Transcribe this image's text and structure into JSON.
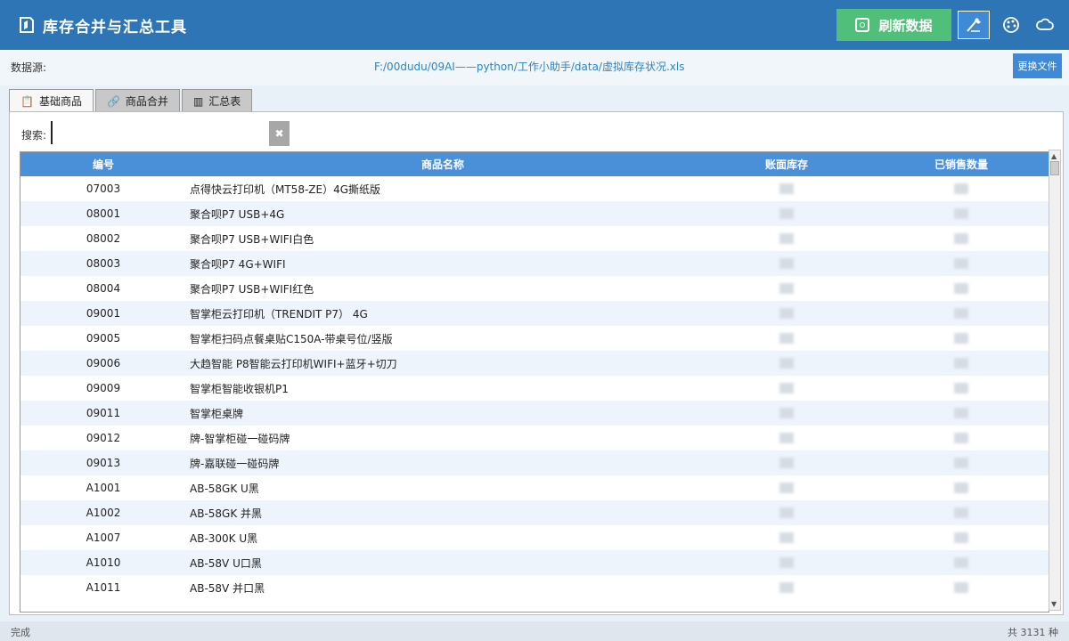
{
  "app": {
    "title": "库存合并与汇总工具"
  },
  "toolbar": {
    "refresh_label": "刷新数据",
    "icons": [
      "wand-icon",
      "palette-icon",
      "cloud-icon"
    ]
  },
  "source": {
    "label": "数据源:",
    "path": "F:/00dudu/09AI——python/工作小助手/data/虚拟库存状况.xls",
    "change_label": "更换文件"
  },
  "tabs": [
    {
      "label": "基础商品",
      "active": true
    },
    {
      "label": "商品合并",
      "active": false
    },
    {
      "label": "汇总表",
      "active": false
    }
  ],
  "search": {
    "label": "搜索:",
    "value": "",
    "clear_label": "✖"
  },
  "table": {
    "columns": [
      "编号",
      "商品名称",
      "账面库存",
      "已销售数量"
    ],
    "rows": [
      [
        "07003",
        "点得快云打印机（MT58-ZE）4G撕纸版"
      ],
      [
        "08001",
        "聚合呗P7 USB+4G"
      ],
      [
        "08002",
        "聚合呗P7 USB+WIFI白色"
      ],
      [
        "08003",
        "聚合呗P7 4G+WIFI"
      ],
      [
        "08004",
        "聚合呗P7 USB+WIFI红色"
      ],
      [
        "09001",
        "智掌柜云打印机（TRENDIT P7） 4G"
      ],
      [
        "09005",
        "智掌柜扫码点餐桌贴C150A-带桌号位/竖版"
      ],
      [
        "09006",
        "大趋智能 P8智能云打印机WIFI+蓝牙+切刀"
      ],
      [
        "09009",
        "智掌柜智能收银机P1"
      ],
      [
        "09011",
        "智掌柜桌牌"
      ],
      [
        "09012",
        "牌-智掌柜碰一碰码牌"
      ],
      [
        "09013",
        "牌-嘉联碰一碰码牌"
      ],
      [
        "A1001",
        "AB-58GK U黑"
      ],
      [
        "A1002",
        "AB-58GK 并黑"
      ],
      [
        "A1007",
        "AB-300K U黑"
      ],
      [
        "A1010",
        "AB-58V U口黑"
      ],
      [
        "A1011",
        "AB-58V 并口黑"
      ]
    ]
  },
  "status": {
    "left": "完成",
    "right": "共 3131 种"
  }
}
